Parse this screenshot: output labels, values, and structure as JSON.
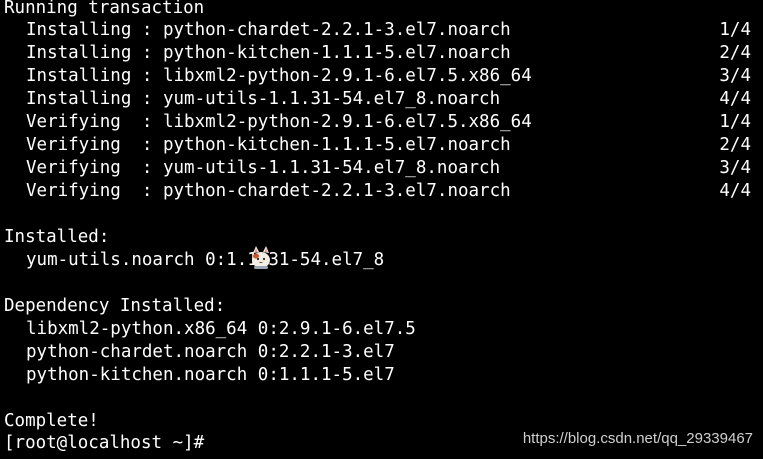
{
  "terminal": {
    "header": "Running transaction",
    "transactions": [
      {
        "action": "Installing",
        "sep": " : ",
        "package": "python-chardet-2.2.1-3.el7.noarch",
        "progress": "1/4"
      },
      {
        "action": "Installing",
        "sep": " : ",
        "package": "python-kitchen-1.1.1-5.el7.noarch",
        "progress": "2/4"
      },
      {
        "action": "Installing",
        "sep": " : ",
        "package": "libxml2-python-2.9.1-6.el7.5.x86_64",
        "progress": "3/4"
      },
      {
        "action": "Installing",
        "sep": " : ",
        "package": "yum-utils-1.1.31-54.el7_8.noarch",
        "progress": "4/4"
      },
      {
        "action": "Verifying",
        "sep": "  : ",
        "package": "libxml2-python-2.9.1-6.el7.5.x86_64",
        "progress": "1/4"
      },
      {
        "action": "Verifying",
        "sep": "  : ",
        "package": "python-kitchen-1.1.1-5.el7.noarch",
        "progress": "2/4"
      },
      {
        "action": "Verifying",
        "sep": "  : ",
        "package": "yum-utils-1.1.31-54.el7_8.noarch",
        "progress": "3/4"
      },
      {
        "action": "Verifying",
        "sep": "  : ",
        "package": "python-chardet-2.2.1-3.el7.noarch",
        "progress": "4/4"
      }
    ],
    "installed_heading": "Installed:",
    "installed_items": [
      "yum-utils.noarch 0:1.1.31-54.el7_8"
    ],
    "dependency_heading": "Dependency Installed:",
    "dependency_items": [
      "libxml2-python.x86_64 0:2.9.1-6.el7.5",
      "python-chardet.noarch 0:2.2.1-3.el7",
      "python-kitchen.noarch 0:1.1.1-5.el7"
    ],
    "complete": "Complete!",
    "prompt": "[root@localhost ~]#"
  },
  "watermark": "https://blog.csdn.net/qq_29339467",
  "colors": {
    "background": "#000000",
    "text": "#ffffff",
    "watermark": "#cfcfcf"
  }
}
